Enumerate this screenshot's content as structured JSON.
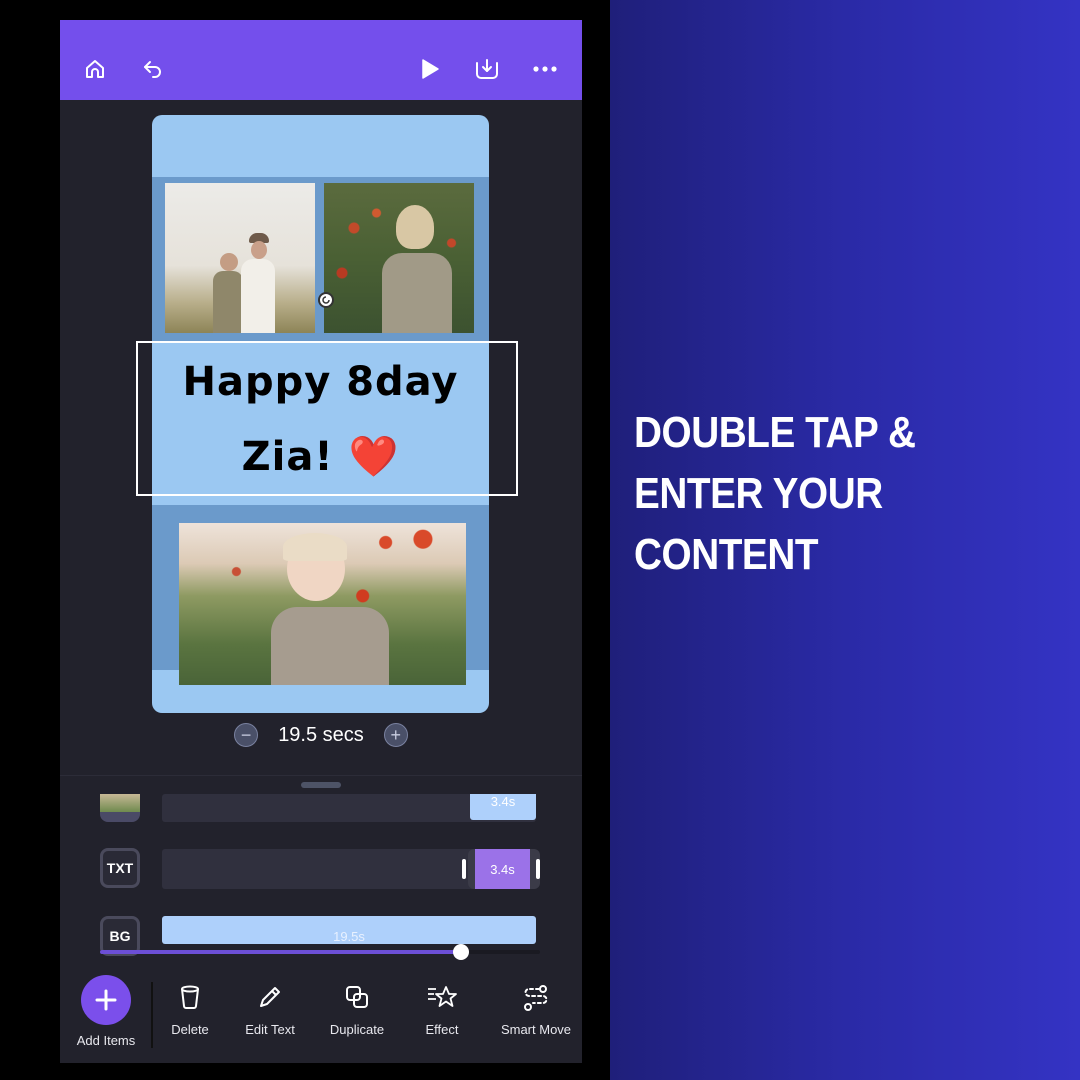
{
  "topbar": {
    "icons": [
      "home-icon",
      "undo-icon",
      "play-icon",
      "download-icon",
      "more-icon"
    ]
  },
  "canvas": {
    "title_line1": "Happy 8day",
    "title_line2": "Zia!",
    "emoji": "❤️",
    "photos": [
      "mother-and-baby-photo",
      "girl-braids-poppies-photo",
      "toddler-poppy-field-photo"
    ]
  },
  "duration": {
    "minus": "−",
    "value": "19.5 secs",
    "plus": "+"
  },
  "timeline": {
    "tracks": [
      {
        "label": "",
        "segment": "3.4s"
      },
      {
        "label": "TXT",
        "segment": "3.4s"
      },
      {
        "label": "BG",
        "segment": "19.5s"
      }
    ],
    "scrub_progress": 0.82
  },
  "toolbar": {
    "add_items": "Add Items",
    "delete": "Delete",
    "edit_text": "Edit Text",
    "duplicate": "Duplicate",
    "effect": "Effect",
    "smart_move": "Smart Move"
  },
  "promo": {
    "headline": "DOUBLE TAP &\nENTER YOUR\nCONTENT"
  },
  "colors": {
    "accent": "#744fec",
    "canvas_bg": "#9bc8f2",
    "txt_segment": "#9b72e8",
    "bg_segment": "#aed0fb"
  }
}
